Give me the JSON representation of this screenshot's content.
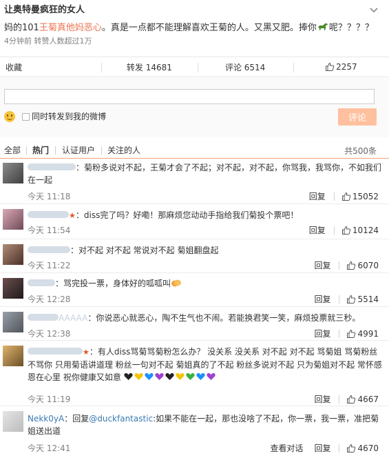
{
  "post": {
    "title": "让奥特曼疯狂的女人",
    "text_pre": "妈的101",
    "text_highlight": "王菊真他妈恶心",
    "text_post": "。真是一点都不能理解喜欢王菊的人。又黑又肥。捧你",
    "text_end": "呢？？？？",
    "meta": "4分钟前 转赞人数超过1万"
  },
  "actions": {
    "favorite": "收藏",
    "repost": "转发 14681",
    "comment": "评论 6514",
    "like_count": "2257"
  },
  "reply_box": {
    "input_value": "",
    "also_repost_label": "同时转发到我的微博",
    "submit_label": "评论"
  },
  "tabs": {
    "all": "全部",
    "hot": "热门",
    "verified": "认证用户",
    "following": "关注的人",
    "total": "共500条"
  },
  "comments": [
    {
      "text": "：菊粉多说对不起，王菊才会了不起；对不起，对不起，你骂我，我骂你，不如我们在一起",
      "time": "今天 11:18",
      "reply": "回复",
      "likes": "15052"
    },
    {
      "text": "：diss完了吗？好嘞！那麻烦您动动手指给我们菊投个票吧！",
      "time": "今天 11:54",
      "reply": "回复",
      "likes": "10124"
    },
    {
      "text": "：对不起 对不起 常说对不起 菊姐翻盘起",
      "time": "今天 11:22",
      "reply": "回复",
      "likes": "6070"
    },
    {
      "text": "：骂完投一票，身体好的呱呱叫",
      "time": "今天 12:28",
      "reply": "回复",
      "likes": "5514"
    },
    {
      "user_partial": "AAAAA",
      "text": "：你说恶心就恶心，陶不生气也不闹。若能换君笑一笑，麻烦投票就三秒。",
      "time": "今天 12:38",
      "reply": "回复",
      "likes": "4991"
    },
    {
      "text_a": "：有人diss骂菊骂菊粉怎么办？ 没关系 没关系 对不起 对不起 骂菊姐 骂菊粉丝不骂你 只用菊语讲道理 粉丝一句对不起 菊姐真的了不起 粉丝多说对不起 只为菊姐对不起 常怀感恩在心里 祝你健康又如意",
      "time": "今天 11:19",
      "reply": "回复",
      "likes": "4667"
    },
    {
      "user": "Nekk0yA",
      "text_pre": "：回复",
      "mention": "@duckfantastic",
      "text": ":如果不能在一起，那也没啥了不起，你一票，我一票，准把菊姐送出道",
      "time": "今天 12:41",
      "view_convo": "查看对话",
      "reply": "回复",
      "likes": "4670"
    }
  ],
  "colors": {
    "accent": "#eb7350",
    "link": "#3a7ab3",
    "submit_disabled": "#ffc09f",
    "tab_underline": "#f0a37c"
  }
}
